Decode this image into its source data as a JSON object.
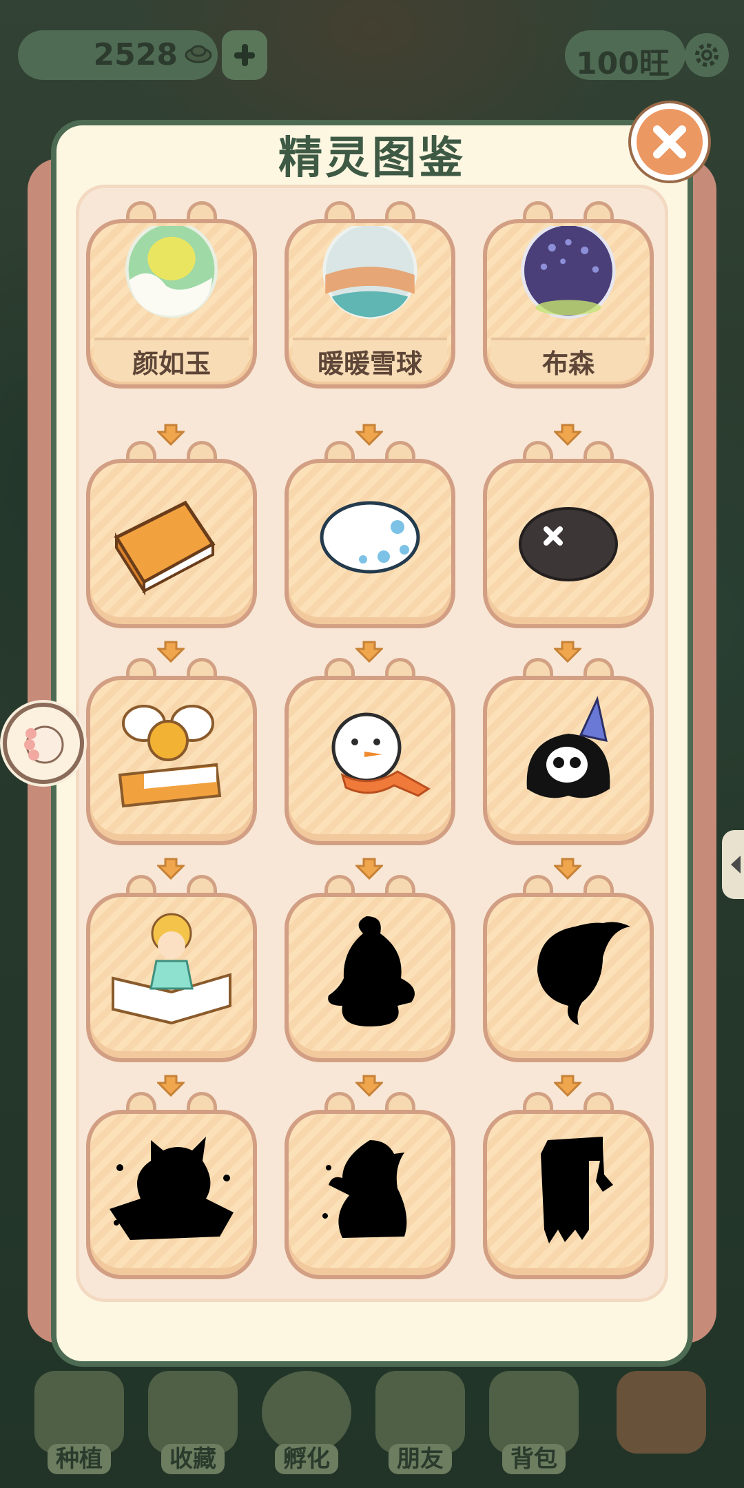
{
  "hud": {
    "coins": "2528",
    "wang": "100旺"
  },
  "modal": {
    "title": "精灵图鉴"
  },
  "eggs": [
    {
      "name": "颜如玉",
      "icon": "green-yellow-egg-icon"
    },
    {
      "name": "暖暖雪球",
      "icon": "snowball-egg-icon"
    },
    {
      "name": "布森",
      "icon": "purple-spotted-egg-icon"
    }
  ],
  "stages": [
    [
      "orange-book-icon",
      "white-blue-spotted-egg-icon",
      "dark-stone-icon"
    ],
    [
      "fairy-on-book-icon",
      "snowman-scarf-icon",
      "skull-ghost-party-hat-icon"
    ],
    [
      "book-fairy-girl-icon",
      "locked-silhouette-icon",
      "locked-silhouette-icon"
    ],
    [
      "locked-silhouette-icon",
      "locked-silhouette-icon",
      "locked-silhouette-icon"
    ]
  ],
  "bottom_nav": [
    {
      "label": "种植",
      "icon": "plant-icon"
    },
    {
      "label": "收藏",
      "icon": "collection-icon"
    },
    {
      "label": "孵化",
      "icon": "hatch-egg-icon"
    },
    {
      "label": "朋友",
      "icon": "friends-icon"
    },
    {
      "label": "背包",
      "icon": "backpack-icon"
    }
  ],
  "colors": {
    "title": "#3e5a45",
    "card_fill": "#fbe0b8",
    "card_border": "#d29f84",
    "close_button": "#ec9862"
  }
}
